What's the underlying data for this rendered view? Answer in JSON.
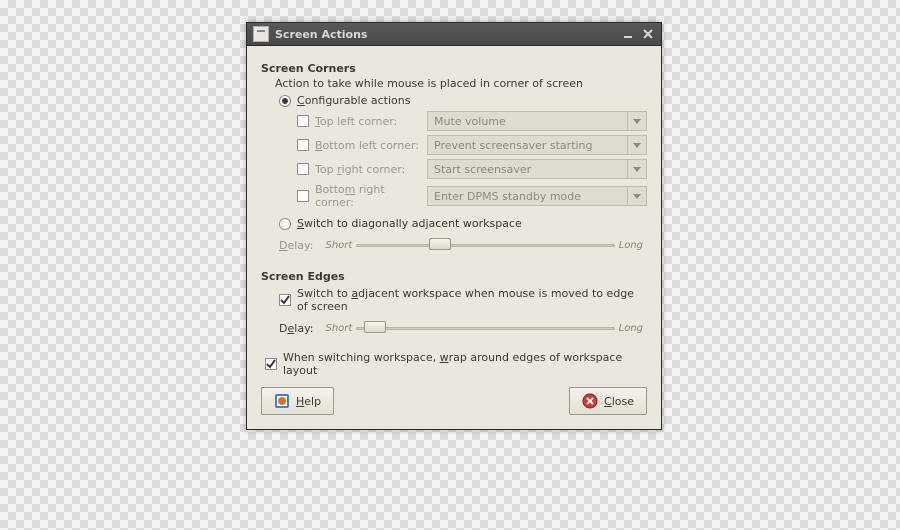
{
  "window": {
    "title": "Screen Actions"
  },
  "corners": {
    "header": "Screen Corners",
    "description": "Action to take while mouse is placed in corner of screen",
    "mode_configurable": "Configurable actions",
    "mode_switch": "Switch to diagonally adjacent workspace",
    "items": [
      {
        "label_pre": "",
        "key": "T",
        "label_post": "op left corner:",
        "action": "Mute volume"
      },
      {
        "label_pre": "",
        "key": "B",
        "label_post": "ottom left corner:",
        "action": "Prevent screensaver starting"
      },
      {
        "label_pre": "Top ",
        "key": "r",
        "label_post": "ight corner:",
        "action": "Start screensaver"
      },
      {
        "label_pre": "Botto",
        "key": "m",
        "label_post": " right corner:",
        "action": "Enter DPMS standby mode"
      }
    ],
    "delay_label_pre": "",
    "delay_key": "D",
    "delay_label_post": "elay:",
    "delay_short": "Short",
    "delay_long": "Long"
  },
  "edges": {
    "header": "Screen Edges",
    "switch_pre": "Switch to ",
    "switch_key": "a",
    "switch_post": "djacent workspace when mouse is moved to edge of screen",
    "delay_label_pre": "D",
    "delay_key": "e",
    "delay_label_post": "lay:",
    "delay_short": "Short",
    "delay_long": "Long"
  },
  "wrap": {
    "pre": "When switching workspace, ",
    "key": "w",
    "post": "rap around edges of workspace layout"
  },
  "buttons": {
    "help_key": "H",
    "help_post": "elp",
    "close_key": "C",
    "close_post": "lose"
  }
}
